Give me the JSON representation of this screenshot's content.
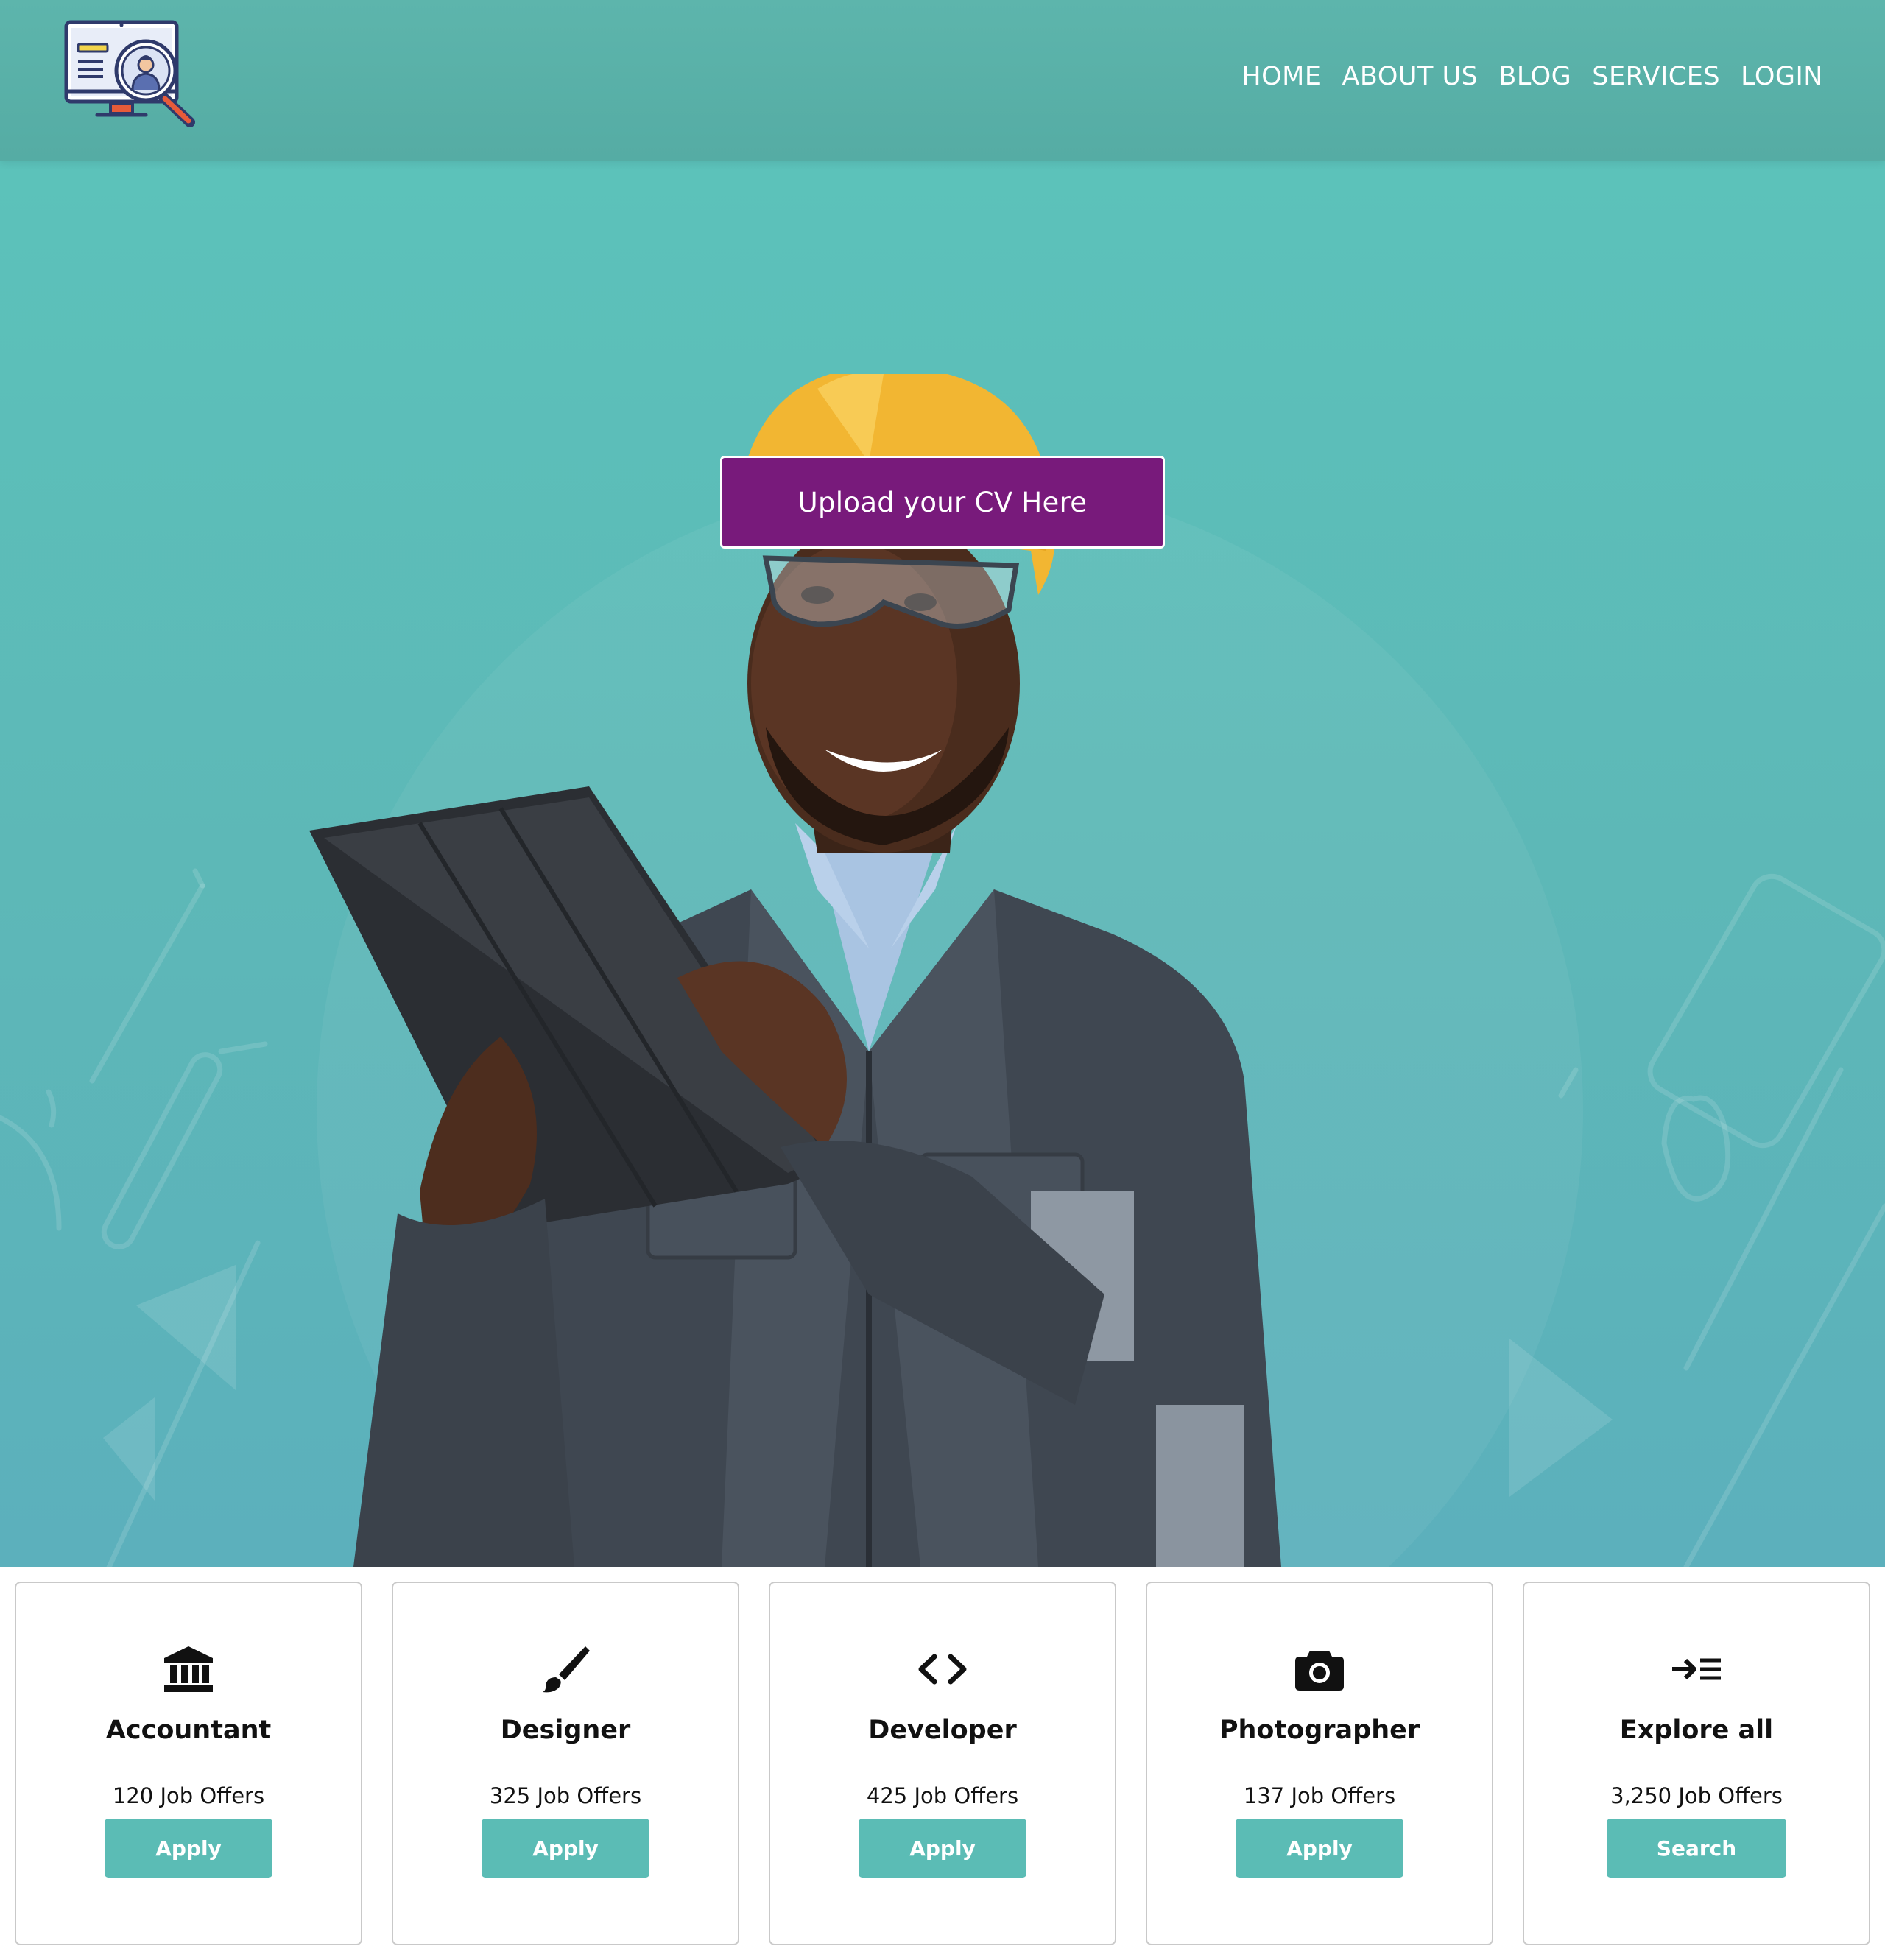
{
  "brand": {
    "logo_icon": "job-search-monitor-icon"
  },
  "nav": {
    "items": [
      {
        "label": "HOME"
      },
      {
        "label": "ABOUT US"
      },
      {
        "label": "BLOG"
      },
      {
        "label": "SERVICES"
      },
      {
        "label": "LOGIN"
      }
    ]
  },
  "hero": {
    "cta_label": "Upload your CV Here",
    "image": "smiling-worker-with-hard-hat-and-tablet"
  },
  "categories": [
    {
      "icon": "bank-icon",
      "title": "Accountant",
      "count": "120 Job Offers",
      "button": "Apply"
    },
    {
      "icon": "paintbrush-icon",
      "title": "Designer",
      "count": "325 Job Offers",
      "button": "Apply"
    },
    {
      "icon": "code-icon",
      "title": "Developer",
      "count": "425 Job Offers",
      "button": "Apply"
    },
    {
      "icon": "camera-icon",
      "title": "Photographer",
      "count": "137 Job Offers",
      "button": "Apply"
    },
    {
      "icon": "indent-arrow-icon",
      "title": "Explore all",
      "count": "3,250 Job Offers",
      "button": "Search"
    }
  ],
  "colors": {
    "header": "#57afa7",
    "hero": "#5cbfb9",
    "cta": "#781a7b",
    "button": "#5bbcb5"
  }
}
